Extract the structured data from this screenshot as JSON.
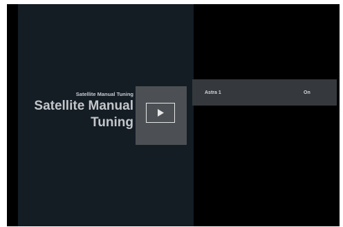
{
  "header": {
    "subtitle": "Satellite Manual Tuning",
    "title": "Satellite Manual Tuning"
  },
  "settings": [
    {
      "name": "Astra 1",
      "value": "On"
    }
  ],
  "icons": {
    "play": "play-icon"
  }
}
